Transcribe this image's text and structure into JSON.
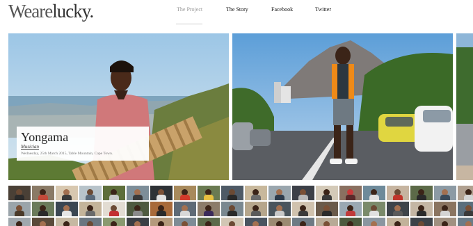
{
  "brand": {
    "logo_light": "Weare",
    "logo_bold": "lucky."
  },
  "nav": [
    {
      "label": "The Project",
      "active": true
    },
    {
      "label": "The Story",
      "active": false
    },
    {
      "label": "Facebook",
      "active": false
    },
    {
      "label": "Twitter",
      "active": false
    }
  ],
  "feature": {
    "name": "Yongama",
    "role": "Musician",
    "meta": "Wednesday, 25th March 2015, Table Mountain, Cape Town."
  },
  "colors": {
    "nav_active": "#999999",
    "text": "#111111",
    "caption_bg": "#ffffff"
  }
}
